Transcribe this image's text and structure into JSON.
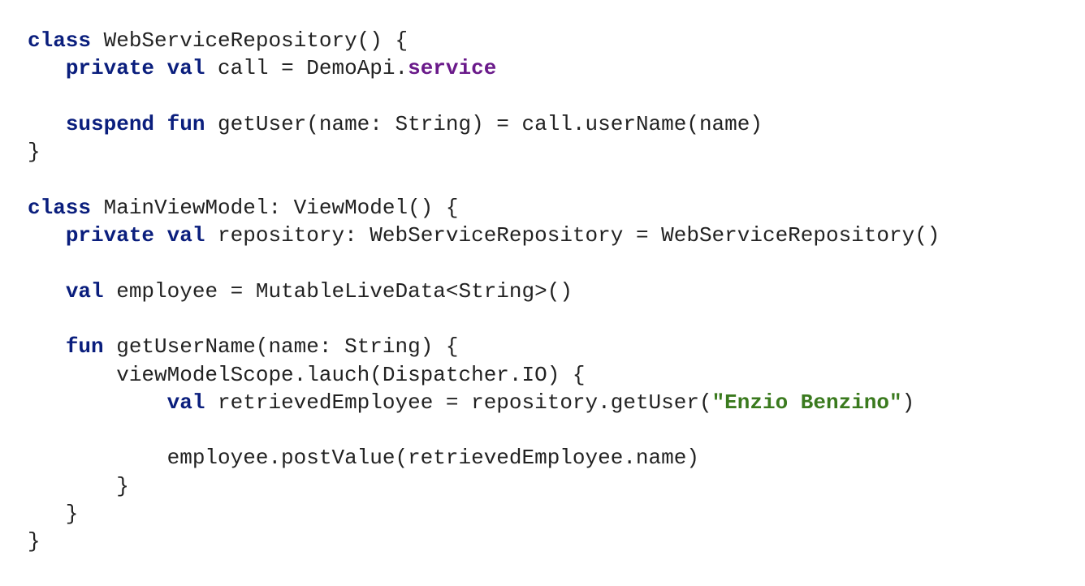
{
  "code": {
    "lines": [
      [
        {
          "t": "class",
          "k": "kw"
        },
        {
          "t": " WebServiceRepository() {",
          "k": "plain"
        }
      ],
      [
        {
          "t": "   ",
          "k": "plain"
        },
        {
          "t": "private val",
          "k": "kw"
        },
        {
          "t": " call = DemoApi.",
          "k": "plain"
        },
        {
          "t": "service",
          "k": "prop"
        }
      ],
      [],
      [
        {
          "t": "   ",
          "k": "plain"
        },
        {
          "t": "suspend fun",
          "k": "kw"
        },
        {
          "t": " getUser(name: String) = call.userName(name)",
          "k": "plain"
        }
      ],
      [
        {
          "t": "}",
          "k": "plain"
        }
      ],
      [],
      [
        {
          "t": "class",
          "k": "kw"
        },
        {
          "t": " MainViewModel: ViewModel() {",
          "k": "plain"
        }
      ],
      [
        {
          "t": "   ",
          "k": "plain"
        },
        {
          "t": "private val",
          "k": "kw"
        },
        {
          "t": " repository: WebServiceRepository = WebServiceRepository()",
          "k": "plain"
        }
      ],
      [],
      [
        {
          "t": "   ",
          "k": "plain"
        },
        {
          "t": "val",
          "k": "kw"
        },
        {
          "t": " employee = MutableLiveData<String>()",
          "k": "plain"
        }
      ],
      [],
      [
        {
          "t": "   ",
          "k": "plain"
        },
        {
          "t": "fun",
          "k": "kw"
        },
        {
          "t": " getUserName(name: String) {",
          "k": "plain"
        }
      ],
      [
        {
          "t": "       viewModelScope.lauch(Dispatcher.IO) {",
          "k": "plain"
        }
      ],
      [
        {
          "t": "           ",
          "k": "plain"
        },
        {
          "t": "val",
          "k": "kw"
        },
        {
          "t": " retrievedEmployee = repository.getUser(",
          "k": "plain"
        },
        {
          "t": "\"Enzio Benzino\"",
          "k": "str"
        },
        {
          "t": ")",
          "k": "plain"
        }
      ],
      [],
      [
        {
          "t": "           employee.postValue(retrievedEmployee.name)",
          "k": "plain"
        }
      ],
      [
        {
          "t": "       }",
          "k": "plain"
        }
      ],
      [
        {
          "t": "   }",
          "k": "plain"
        }
      ],
      [
        {
          "t": "}",
          "k": "plain"
        }
      ]
    ]
  }
}
